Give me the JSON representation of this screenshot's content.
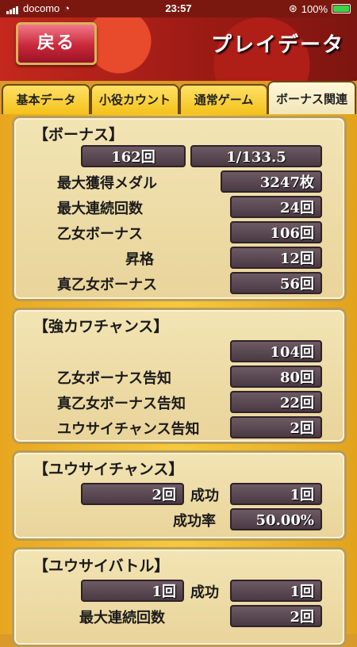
{
  "status": {
    "carrier": "docomo",
    "time": "23:57",
    "battery": "100%"
  },
  "header": {
    "back_label": "戻る",
    "title": "プレイデータ"
  },
  "tabs": [
    "基本データ",
    "小役カウント",
    "通常ゲーム",
    "ボーナス関連"
  ],
  "bonus": {
    "title": "【ボーナス】",
    "count": "162回",
    "ratio": "1/133.5",
    "rows": [
      {
        "label": "最大獲得メダル",
        "value": "3247枚"
      },
      {
        "label": "最大連続回数",
        "value": "24回"
      },
      {
        "label": "乙女ボーナス",
        "value": "106回"
      },
      {
        "label": "昇格",
        "value": "12回"
      },
      {
        "label": "真乙女ボーナス",
        "value": "56回"
      }
    ]
  },
  "kyouka": {
    "title": "【強カワチャンス】",
    "total": "104回",
    "rows": [
      {
        "label": "乙女ボーナス告知",
        "value": "80回"
      },
      {
        "label": "真乙女ボーナス告知",
        "value": "22回"
      },
      {
        "label": "ユウサイチャンス告知",
        "value": "2回"
      }
    ]
  },
  "yuusai_chance": {
    "title": "【ユウサイチャンス】",
    "count": "2回",
    "success_label": "成功",
    "success": "1回",
    "rate_label": "成功率",
    "rate": "50.00%"
  },
  "yuusai_battle": {
    "title": "【ユウサイバトル】",
    "count": "1回",
    "success_label": "成功",
    "success": "1回",
    "max_label": "最大連続回数",
    "max": "2回"
  }
}
